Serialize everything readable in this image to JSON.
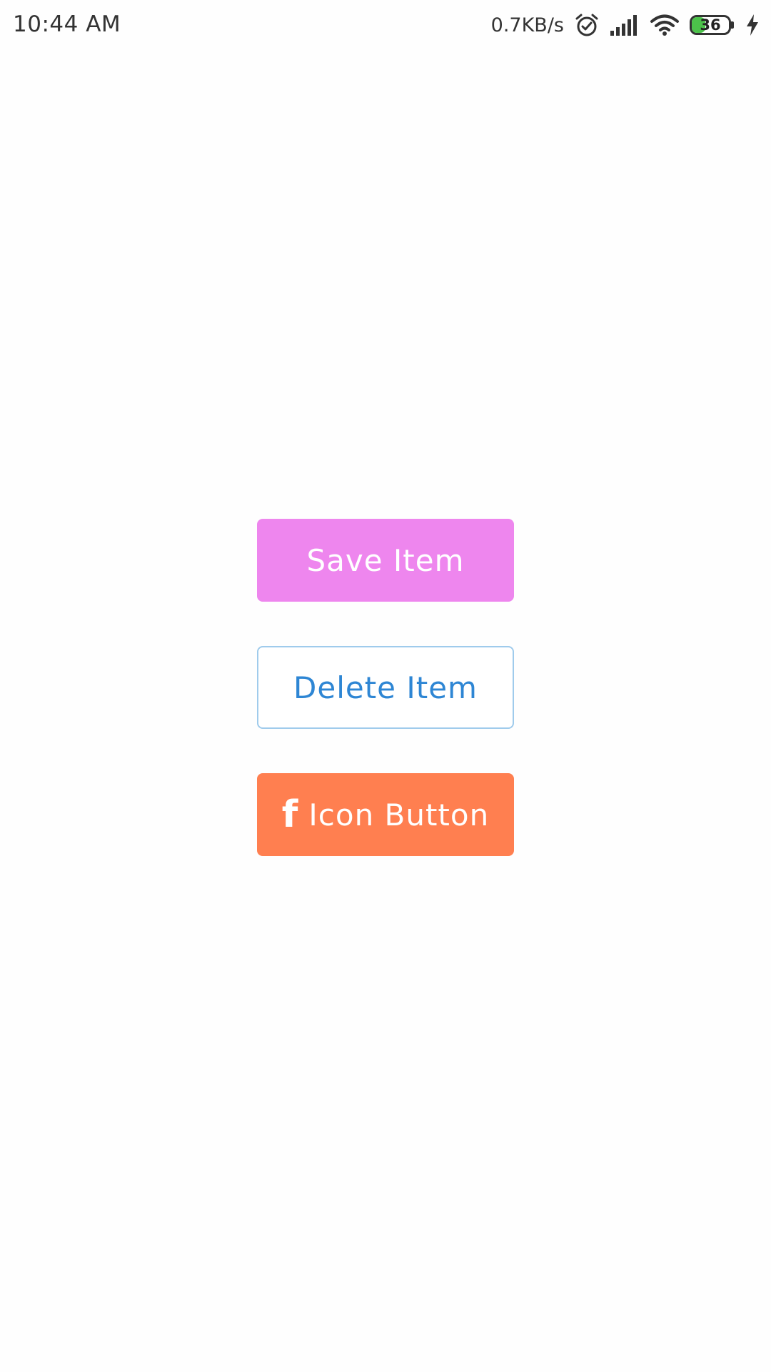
{
  "status_bar": {
    "time": "10:44 AM",
    "net_speed": "0.7KB/s",
    "battery_level": "36",
    "icons": [
      "alarm-icon",
      "signal-icon",
      "wifi-icon",
      "battery-icon",
      "charging-icon"
    ],
    "battery_fill_fraction": 0.36,
    "battery_fill_color": "#4cc24a"
  },
  "buttons": {
    "save_label": "Save Item",
    "delete_label": "Delete Item",
    "icon_button_label": "Icon Button",
    "icon_button_icon": "facebook-icon",
    "colors": {
      "save_bg": "#ee86ee",
      "delete_text": "#2e86d4",
      "delete_border": "#9fcbec",
      "icon_bg": "#ff7f50"
    }
  }
}
